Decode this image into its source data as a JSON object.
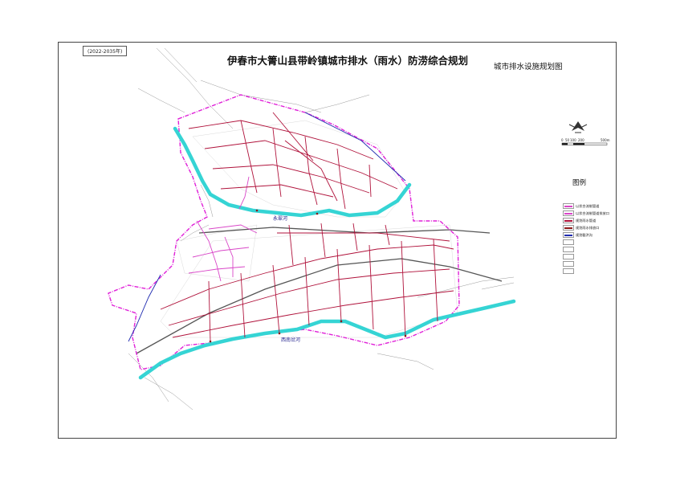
{
  "sheet": {
    "period": "(2022-2035年)",
    "title": "伊春市大箐山县带岭镇城市排水（雨水）防涝综合规划",
    "subtitle": "城市排水设施规划图"
  },
  "scale_bar": {
    "labels": [
      "0",
      "50",
      "100",
      "200",
      "",
      "500m"
    ]
  },
  "map_labels": {
    "north_river": "永翠河",
    "south_river": "西南岔河"
  },
  "legend": {
    "title": "图例",
    "items": [
      {
        "label": "以状合流制管道",
        "color": "#d946c8"
      },
      {
        "label": "以状合流制管道排放口",
        "color": "#d946c8"
      },
      {
        "label": "规划雨水管道",
        "color": "#b0123b"
      },
      {
        "label": "规划雨水排放口",
        "color": "#8b1a1a"
      },
      {
        "label": "规划截洪沟",
        "color": "#1f2bb0"
      },
      {
        "label": "",
        "color": ""
      },
      {
        "label": "",
        "color": ""
      },
      {
        "label": "",
        "color": ""
      },
      {
        "label": "",
        "color": ""
      },
      {
        "label": "",
        "color": ""
      }
    ]
  },
  "colors": {
    "river": "#35d4d4",
    "boundary": "#e020d8",
    "rain_pipe": "#b0123b",
    "combined_pipe": "#d946c8",
    "flood_ditch": "#1f2bb0",
    "base_map": "#9a9a9a"
  }
}
